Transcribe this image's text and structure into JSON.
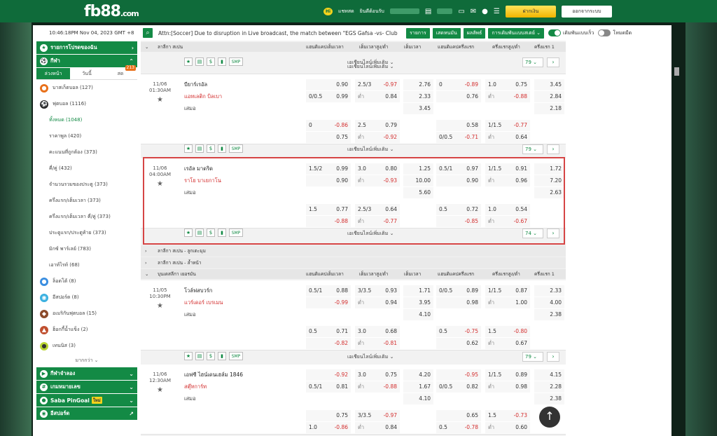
{
  "header": {
    "logo": "fb88",
    "logo_suffix": ".com",
    "chat": "แชทสด",
    "welcome": "ยินดีต้อนรับ",
    "deposit": "ฝากเงิน",
    "logout": "ออกจากระบบ"
  },
  "sidebar": {
    "clock": "10:46:18PM Nov 04, 2023 GMT +8",
    "favorites": "รายการโปรดของฉัน",
    "sports": "กีฬา",
    "tabs": [
      "ล่วงหน้า",
      "วันนี้",
      "สด"
    ],
    "live_count": "213",
    "basketball": "บาสเก็ตบอล (127)",
    "football": "ฟุตบอล (1116)",
    "sub": [
      "ทั้งหมด (1048)",
      "ราคาพูล (420)",
      "คะแนนที่ถูกต้อง (373)",
      "คี่/คู่ (432)",
      "จำนวนรวมของประตู (373)",
      "ครึ่งแรก/เต็มเวลา (373)",
      "ครึ่งแรก/เต็มเวลา คี่/คู่ (373)",
      "ประตูแรก/ประตูท้าย (373)",
      "มิกซ์ พาร์เลย์ (783)",
      "เอาท์ไรท์ (68)"
    ],
    "others": [
      "ล็อตโต้ (8)",
      "อีสปอร์ต (8)",
      "อเมริกันฟุตบอล (15)",
      "ฮ็อกกี้น้ำแข็ง (2)",
      "เทนนิส (3)"
    ],
    "more": "มากกว่า",
    "virtual": "กีฬาจำลอง",
    "number": "เกมหมายเลข",
    "pingoal": "Saba PinGoal",
    "new": "ใหม่",
    "esports": "อีสปอร์ต"
  },
  "toolbar": {
    "notice": "Attn:[Soccer] Due to disruption in Live broadcast, the match between \"EGS Gafsa -vs- Club",
    "btn_list": "รายการ",
    "btn_parlay": "เสดหนมัน",
    "btn_results": "ผลลัพธ์",
    "btn_setting": "การเดิมพันแบบสเตย์",
    "toggle1": "เดิมพันแบบเร็ว",
    "toggle2": "โหมดมืด"
  },
  "cols": {
    "hdp": "แฮนดิแคปเต็มเวลา",
    "ou": "เต็มเวลาสูง/ต่ำ",
    "x12": "เต็มเวลา",
    "hdp1h": "แฮนดิแคปครึ่งแรก",
    "ou1h": "ครึ่งแรกสูง/ต่ำ",
    "x121h": "ครึ่งแรก 1"
  },
  "leagues": {
    "spain1": "ลาลีกา สเปน",
    "spain_corner": "ลาลีกา สเปน - ลูกเตะมุม",
    "spain_book": "ลาลีกา สเปน - ล้ำหน้า",
    "bundes": "บุนเดสลีกา เยอรมัน"
  },
  "actions": {
    "more": "เอเชียนไลน์เพิ่มเติม",
    "smp": "SMP",
    "low": "ต่ำ",
    "draw": "เสมอ"
  },
  "matches": [
    {
      "date": "11/06",
      "time": "01:30AM",
      "home": "บียาร์เรอัล",
      "away": "แอทเลติก บิลเบา",
      "count": "79",
      "r1": [
        [
          "",
          "0.90"
        ],
        [
          "2.5/3",
          "-0.97"
        ],
        "2.76",
        [
          "0",
          "-0.89"
        ],
        [
          "1.0",
          "0.75"
        ],
        "3.45"
      ],
      "r2": [
        [
          "0/0.5",
          "0.99"
        ],
        [
          "ต่ำ",
          "0.84"
        ],
        "2.33",
        [
          "",
          "0.76"
        ],
        [
          "ต่ำ",
          "-0.88"
        ],
        "2.84"
      ],
      "r3": "3.45",
      "r3b": "2.18",
      "r4": [
        [
          "0",
          "-0.86"
        ],
        [
          "2.5",
          "0.79"
        ],
        [
          "",
          "0.58"
        ],
        [
          "1/1.5",
          "-0.77"
        ]
      ],
      "r5": [
        [
          "",
          "0.75"
        ],
        [
          "ต่ำ",
          "-0.92"
        ],
        [
          "0/0.5",
          "-0.71"
        ],
        [
          "ต่ำ",
          "0.64"
        ]
      ]
    },
    {
      "date": "11/06",
      "time": "04:00AM",
      "home": "เรอัล มาดริด",
      "away": "ราโย บาเยกาโน",
      "count": "74",
      "r1": [
        [
          "1.5/2",
          "0.99"
        ],
        [
          "3.0",
          "0.80"
        ],
        "1.25",
        [
          "0.5/1",
          "0.97"
        ],
        [
          "1/1.5",
          "0.91"
        ],
        "1.72"
      ],
      "r2": [
        [
          "",
          "0.90"
        ],
        [
          "ต่ำ",
          "-0.93"
        ],
        "10.00",
        [
          "",
          "0.90"
        ],
        [
          "ต่ำ",
          "0.96"
        ],
        "7.20"
      ],
      "r3": "5.60",
      "r3b": "2.63",
      "r4": [
        [
          "1.5",
          "0.77"
        ],
        [
          "2.5/3",
          "0.64"
        ],
        [
          "0.5",
          "0.72"
        ],
        [
          "1.0",
          "0.54"
        ]
      ],
      "r5": [
        [
          "",
          "-0.88"
        ],
        [
          "ต่ำ",
          "-0.77"
        ],
        [
          "",
          "-0.85"
        ],
        [
          "ต่ำ",
          "-0.67"
        ]
      ]
    },
    {
      "date": "11/05",
      "time": "10:30PM",
      "home": "โวล์ฟสบวร์ก",
      "away": "แวร์เดอร์ เบรเมน",
      "count": "79",
      "r1": [
        [
          "0.5/1",
          "0.88"
        ],
        [
          "3/3.5",
          "0.93"
        ],
        "1.71",
        [
          "0/0.5",
          "0.89"
        ],
        [
          "1/1.5",
          "0.87"
        ],
        "2.33"
      ],
      "r2": [
        [
          "",
          "-0.99"
        ],
        [
          "ต่ำ",
          "0.94"
        ],
        "3.95",
        [
          "",
          "0.98"
        ],
        [
          "ต่ำ",
          "1.00"
        ],
        "4.00"
      ],
      "r3": "4.10",
      "r3b": "2.38",
      "r4": [
        [
          "0.5",
          "0.71"
        ],
        [
          "3.0",
          "0.68"
        ],
        [
          "0.5",
          "-0.75"
        ],
        [
          "1.5",
          "-0.80"
        ]
      ],
      "r5": [
        [
          "",
          "-0.82"
        ],
        [
          "ต่ำ",
          "-0.81"
        ],
        [
          "",
          "0.62"
        ],
        [
          "ต่ำ",
          "0.67"
        ]
      ]
    },
    {
      "date": "11/06",
      "time": "12:30AM",
      "home": "เอฟซี ไฮน์เดนเฮล์ม 1846",
      "away": "สตุ๊ทการ์ท",
      "count": "",
      "r1": [
        [
          "",
          "-0.92"
        ],
        [
          "3.0",
          "0.75"
        ],
        "4.20",
        [
          "",
          "-0.95"
        ],
        [
          "1/1.5",
          "0.89"
        ],
        "4.15"
      ],
      "r2": [
        [
          "0.5/1",
          "0.81"
        ],
        [
          "ต่ำ",
          "-0.88"
        ],
        "1.67",
        [
          "0/0.5",
          "0.82"
        ],
        [
          "ต่ำ",
          "0.98"
        ],
        "2.28"
      ],
      "r3": "4.10",
      "r3b": "2.38",
      "r4": [
        [
          "",
          "0.75"
        ],
        [
          "3/3.5",
          "-0.97"
        ],
        [
          "",
          "0.65"
        ],
        [
          "1.5",
          "-0.73"
        ]
      ],
      "r5": [
        [
          "1.0",
          "-0.86"
        ],
        [
          "ต่ำ",
          "0.84"
        ],
        [
          "0.5",
          "-0.78"
        ],
        [
          "ต่ำ",
          "0.60"
        ]
      ]
    }
  ]
}
